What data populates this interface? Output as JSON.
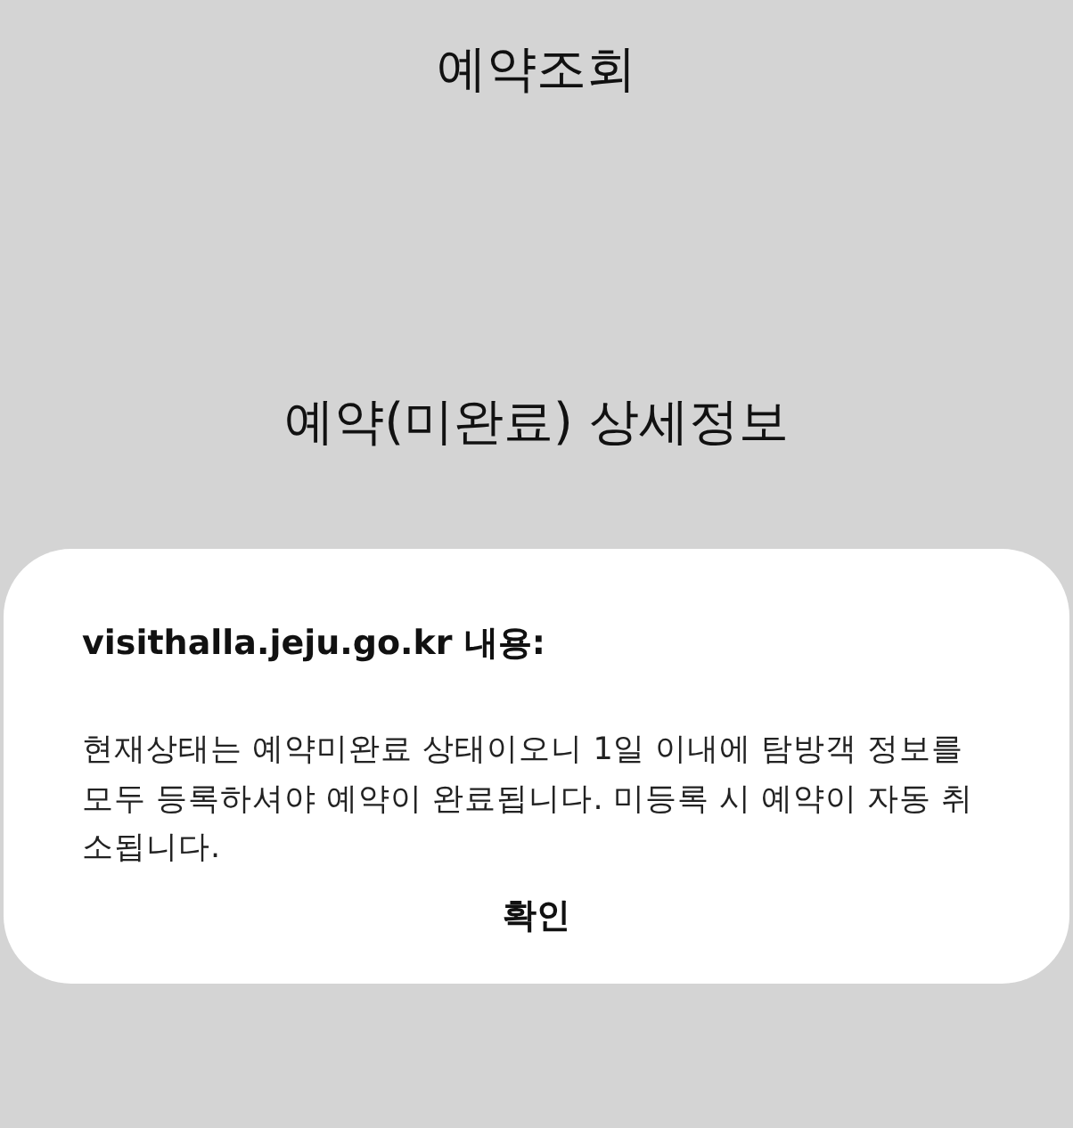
{
  "page": {
    "title": "예약조회",
    "subtitle": "예약(미완료) 상세정보"
  },
  "dialog": {
    "title": "visithalla.jeju.go.kr 내용:",
    "message": "현재상태는 예약미완료 상태이오니 1일 이내에 탐방객 정보를 모두 등록하셔야 예약이 완료됩니다. 미등록 시 예약이 자동 취소됩니다.",
    "buttons": [
      "확인"
    ]
  }
}
